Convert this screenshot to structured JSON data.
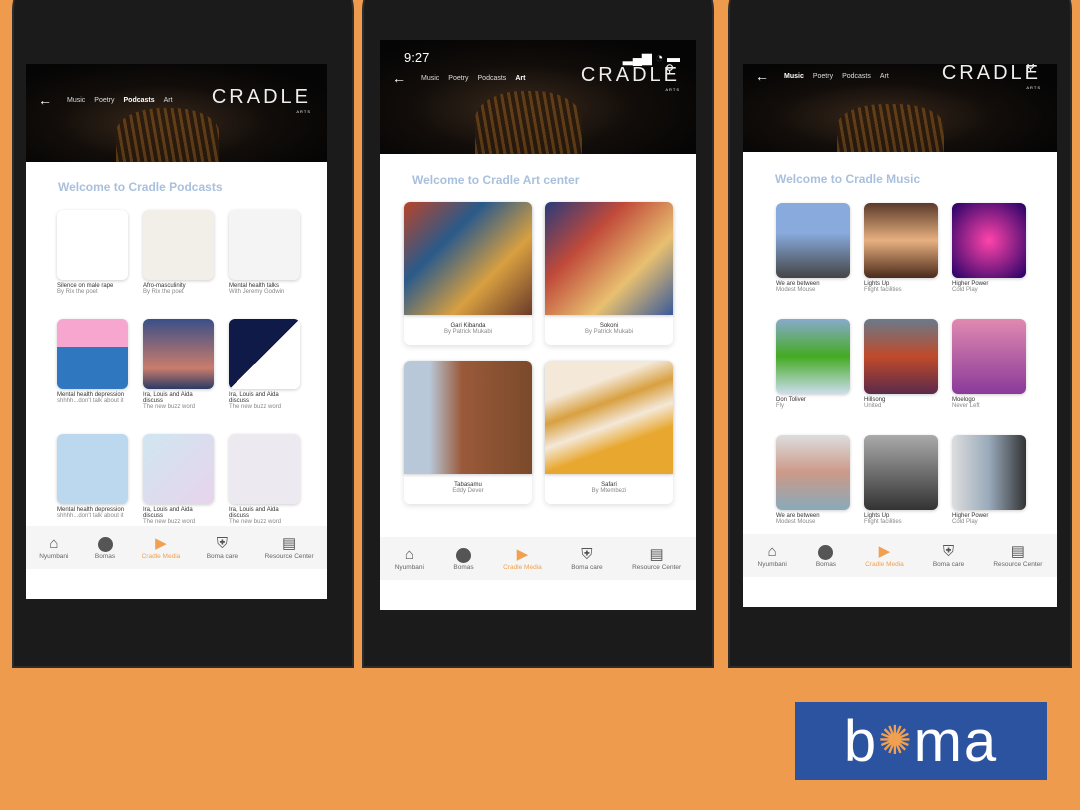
{
  "colors": {
    "accent": "#f0a050",
    "title": "#a9c0dd",
    "background": "#ee9b4d",
    "boma_blue": "#2b53a0"
  },
  "logo_text": "CRADLE",
  "logo_sub": "ARTS",
  "status_time": "9:27",
  "nav": [
    {
      "label": "Nyumbani",
      "icon": "home-icon"
    },
    {
      "label": "Bomas",
      "icon": "circle-icon"
    },
    {
      "label": "Cradle Media",
      "icon": "play-icon"
    },
    {
      "label": "Boma care",
      "icon": "shield-plus-icon"
    },
    {
      "label": "Resource Center",
      "icon": "library-icon"
    }
  ],
  "top_tabs": [
    "Music",
    "Poetry",
    "Podcasts",
    "Art"
  ],
  "podcasts": {
    "title": "Welcome to Cradle Podcasts",
    "active_tab": "Podcasts",
    "items": [
      {
        "name": "Silence on male rape",
        "sub": "By Rix the poet",
        "bg": "#fff"
      },
      {
        "name": "Afro-masculinity",
        "sub": "By Rix the poet",
        "bg": "#f2efe9"
      },
      {
        "name": "Mental health talks",
        "sub": "With Jeremy Godwin",
        "bg": "#f4f4f4"
      },
      {
        "name": "Mental health depression",
        "sub": "shhhh...don't talk about it",
        "bg": "linear-gradient(#f7a6d0 40%,#2f78c0 40%)"
      },
      {
        "name": "Ira, Louis and Aida discuss",
        "sub": "The new buzz word",
        "bg": "linear-gradient(#3a4f88,#c97c6c 70%,#2a3a66)"
      },
      {
        "name": "Ira, Louis and Aida discuss",
        "sub": "The new buzz word",
        "bg": "linear-gradient(135deg,#0f1a48 50%,#fff 50%)"
      },
      {
        "name": "Mental health depression",
        "sub": "shhhh...don't talk about it",
        "bg": "#bcd8ee"
      },
      {
        "name": "Ira, Louis and Aida discuss",
        "sub": "The new buzz word",
        "bg": "linear-gradient(135deg,#cfe6f0,#e8d4ec)"
      },
      {
        "name": "Ira, Louis and Aida discuss",
        "sub": "The new buzz word",
        "bg": "#eceaf0"
      }
    ]
  },
  "art": {
    "title": "Welcome to Cradle Art center",
    "active_tab": "Art",
    "items": [
      {
        "name": "Gari Kibanda",
        "sub": "By Patrick Mukabi",
        "bg": "linear-gradient(135deg,#b8442a,#2a5a8a,#d8a040,#6a3a2a)"
      },
      {
        "name": "Sokoni",
        "sub": "By Patrick Mukabi",
        "bg": "linear-gradient(135deg,#2a3a7a,#c04a3a,#e8c070,#3a5a9a)"
      },
      {
        "name": "Tabasamu",
        "sub": "Eddy Dever",
        "bg": "linear-gradient(90deg,#b8c8d8 20%,#9a5a3a 45%,#7a4a2a)"
      },
      {
        "name": "Safari",
        "sub": "By Mtembezi",
        "bg": "linear-gradient(160deg,#f4e8d8 25%,#d8a040 40%,#f4e8d8 55%,#e8a830 70%)"
      }
    ]
  },
  "music": {
    "title": "Welcome to Cradle Music",
    "active_tab": "Music",
    "items": [
      {
        "name": "We are between",
        "sub": "Modest Mouse",
        "bg": "linear-gradient(#8ad 40%,#444)"
      },
      {
        "name": "Lights Up",
        "sub": "Flight facilities",
        "bg": "linear-gradient(#5a3a2a,#e8b080,#4a2a1a)"
      },
      {
        "name": "Higher Power",
        "sub": "Cold Play",
        "bg": "radial-gradient(#f4a,#206)"
      },
      {
        "name": "Don Toliver",
        "sub": "Fly",
        "bg": "linear-gradient(#8ac,#4a2 50%,#cde)"
      },
      {
        "name": "Hillsong",
        "sub": "United",
        "bg": "linear-gradient(#6a7a8a,#c04a2a,#5a2a4a)"
      },
      {
        "name": "Moelogo",
        "sub": "Never Left",
        "bg": "linear-gradient(#e08ab0,#8a3a9a)"
      },
      {
        "name": "We are between",
        "sub": "Modest Mouse",
        "bg": "linear-gradient(#ddd,#c98,#8ab)"
      },
      {
        "name": "Lights Up",
        "sub": "Flight facilities",
        "bg": "linear-gradient(#aaa,#333)"
      },
      {
        "name": "Higher Power",
        "sub": "Cold Play",
        "bg": "linear-gradient(90deg,#ddd,#9ab,#333)"
      }
    ]
  },
  "brand": "boma"
}
